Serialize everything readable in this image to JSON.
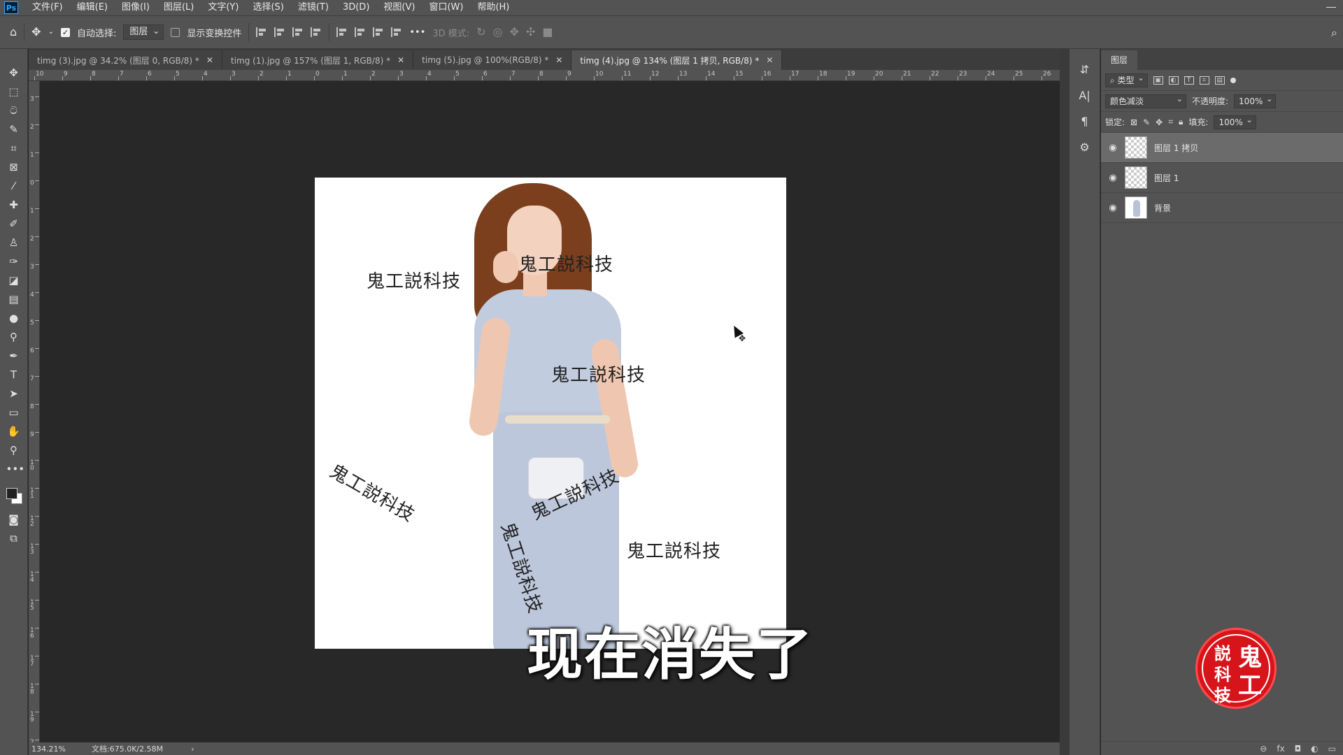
{
  "app": {
    "logo": "Ps",
    "menu": [
      "文件(F)",
      "编辑(E)",
      "图像(I)",
      "图层(L)",
      "文字(Y)",
      "选择(S)",
      "滤镜(T)",
      "3D(D)",
      "视图(V)",
      "窗口(W)",
      "帮助(H)"
    ]
  },
  "options_bar": {
    "auto_select_label": "自动选择:",
    "auto_select_checked": true,
    "target_select": "图层",
    "show_transform_label": "显示变换控件",
    "show_transform_checked": false,
    "more": "•••",
    "mode_3d_label": "3D 模式:"
  },
  "tabs": [
    {
      "label": "timg (3).jpg @ 34.2% (图层 0, RGB/8) *",
      "active": false
    },
    {
      "label": "timg (1).jpg @ 157% (图层 1, RGB/8) *",
      "active": false
    },
    {
      "label": "timg (5).jpg @ 100%(RGB/8) *",
      "active": false
    },
    {
      "label": "timg (4).jpg @ 134% (图层 1 拷贝, RGB/8) *",
      "active": true
    }
  ],
  "ruler": {
    "h_labels": [
      "10",
      "9",
      "8",
      "7",
      "6",
      "5",
      "4",
      "3",
      "2",
      "1",
      "0",
      "1",
      "2",
      "3",
      "4",
      "5",
      "6",
      "7",
      "8",
      "9",
      "10",
      "11",
      "12",
      "13",
      "14",
      "15",
      "16",
      "17",
      "18",
      "19",
      "20",
      "21",
      "22",
      "23",
      "24",
      "25",
      "26"
    ],
    "v_labels": [
      "3",
      "2",
      "1",
      "0",
      "1",
      "2",
      "3",
      "4",
      "5",
      "6",
      "7",
      "8",
      "9",
      "1 0",
      "1 1",
      "1 2",
      "1 3",
      "1 4",
      "1 5",
      "1 6",
      "1 7",
      "1 8",
      "1 9",
      "2"
    ]
  },
  "canvas": {
    "watermarks": [
      "鬼工説科技",
      "鬼工説科技",
      "鬼工説科技",
      "鬼工説科技",
      "鬼工説科技",
      "鬼工説科技",
      "鬼工説科技"
    ],
    "subtitle": "现在消失了"
  },
  "status": {
    "zoom": "134.21%",
    "doc": "文档:675.0K/2.58M",
    "arrow": "›"
  },
  "layers_panel": {
    "tab": "图层",
    "filter_kind": "类型",
    "blend_mode": "颜色减淡",
    "opacity_label": "不透明度:",
    "opacity_value": "100%",
    "lock_label": "锁定:",
    "fill_label": "填充:",
    "fill_value": "100%",
    "layers": [
      {
        "name": "图层 1 拷贝",
        "selected": true,
        "thumb": "transparent"
      },
      {
        "name": "图层 1",
        "selected": false,
        "thumb": "transparent"
      },
      {
        "name": "背景",
        "selected": false,
        "thumb": "photo"
      }
    ],
    "footer": [
      "⊖",
      "fx",
      "◘",
      "◐",
      "▭"
    ]
  },
  "stamp": {
    "chars": [
      "鬼",
      "工",
      "説",
      "科",
      "技"
    ]
  },
  "colors": {
    "ui_bg": "#535353",
    "canvas_bg": "#282828",
    "stamp_red": "#d8141b"
  }
}
